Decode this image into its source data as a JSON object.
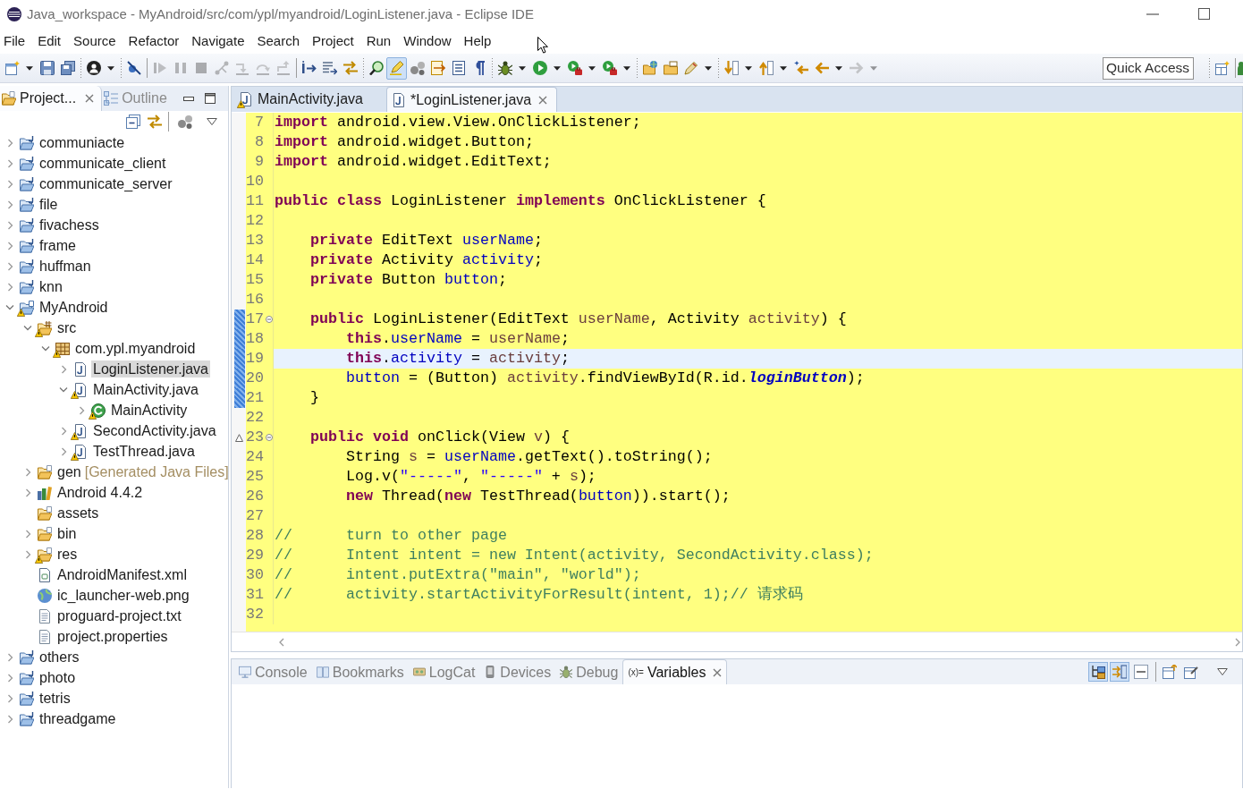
{
  "window": {
    "title": "Java_workspace - MyAndroid/src/com/ypl/myandroid/LoginListener.java - Eclipse IDE"
  },
  "menu": [
    "File",
    "Edit",
    "Source",
    "Refactor",
    "Navigate",
    "Search",
    "Project",
    "Run",
    "Window",
    "Help"
  ],
  "toolbar": {
    "buttons": [
      {
        "selected": false,
        "disabled": false
      },
      {
        "selected": false,
        "disabled": false
      },
      {
        "selected": false,
        "disabled": false
      },
      {
        "selected": false,
        "disabled": false
      },
      {
        "selected": false,
        "disabled": false
      },
      {
        "selected": false,
        "disabled": true
      },
      {
        "selected": false,
        "disabled": true
      },
      {
        "selected": false,
        "disabled": true
      },
      {
        "selected": false,
        "disabled": true
      },
      {
        "selected": false,
        "disabled": true
      },
      {
        "selected": false,
        "disabled": true
      },
      {
        "selected": false,
        "disabled": true
      },
      {
        "selected": false,
        "disabled": false
      },
      {
        "selected": false,
        "disabled": false
      },
      {
        "selected": false,
        "disabled": false
      },
      {
        "selected": false,
        "disabled": false
      },
      {
        "selected": true,
        "disabled": false
      },
      {
        "selected": false,
        "disabled": false
      },
      {
        "selected": false,
        "disabled": false
      },
      {
        "selected": false,
        "disabled": false
      },
      {
        "selected": false,
        "disabled": false
      },
      {
        "selected": false,
        "disabled": false
      },
      {
        "selected": false,
        "disabled": false
      },
      {
        "selected": false,
        "disabled": false
      },
      {
        "selected": false,
        "disabled": false
      },
      {
        "selected": false,
        "disabled": false
      },
      {
        "selected": false,
        "disabled": false
      },
      {
        "selected": false,
        "disabled": false
      },
      {
        "selected": false,
        "disabled": false
      },
      {
        "selected": false,
        "disabled": false
      },
      {
        "selected": false,
        "disabled": false
      },
      {
        "selected": false,
        "disabled": false
      },
      {
        "selected": false,
        "disabled": true
      }
    ],
    "quick_access": {
      "placeholder": "Quick Access"
    }
  },
  "project_explorer": {
    "tabs": [
      {
        "label": "Project...",
        "selected": true
      },
      {
        "label": "Outline",
        "selected": false
      }
    ],
    "tree": [
      {
        "label": "communiacte",
        "kind": "project",
        "expanded": false,
        "selected": false,
        "warning": false
      },
      {
        "label": "communicate_client",
        "kind": "project",
        "expanded": false,
        "selected": false,
        "warning": false
      },
      {
        "label": "communicate_server",
        "kind": "project",
        "expanded": false,
        "selected": false,
        "warning": false
      },
      {
        "label": "file",
        "kind": "project",
        "expanded": false,
        "selected": false,
        "warning": false
      },
      {
        "label": "fivachess",
        "kind": "project",
        "expanded": false,
        "selected": false,
        "warning": false
      },
      {
        "label": "frame",
        "kind": "project",
        "expanded": false,
        "selected": false,
        "warning": false
      },
      {
        "label": "huffman",
        "kind": "project",
        "expanded": false,
        "selected": false,
        "warning": false
      },
      {
        "label": "knn",
        "kind": "project",
        "expanded": false,
        "selected": false,
        "warning": false
      },
      {
        "label": "MyAndroid",
        "kind": "android-project",
        "expanded": true,
        "selected": false,
        "warning": true,
        "children": [
          {
            "label": "src",
            "kind": "source-folder",
            "expanded": true,
            "selected": false,
            "warning": true,
            "children": [
              {
                "label": "com.ypl.myandroid",
                "kind": "package",
                "expanded": true,
                "selected": false,
                "warning": true,
                "children": [
                  {
                    "label": "LoginListener.java",
                    "kind": "java-file",
                    "expanded": false,
                    "selected": true,
                    "warning": false
                  },
                  {
                    "label": "MainActivity.java",
                    "kind": "java-file",
                    "expanded": true,
                    "selected": false,
                    "warning": true,
                    "children": [
                      {
                        "label": "MainActivity",
                        "kind": "class",
                        "expanded": false,
                        "selected": false,
                        "warning": true
                      }
                    ]
                  },
                  {
                    "label": "SecondActivity.java",
                    "kind": "java-file",
                    "expanded": false,
                    "selected": false,
                    "warning": true
                  },
                  {
                    "label": "TestThread.java",
                    "kind": "java-file",
                    "expanded": false,
                    "selected": false,
                    "warning": true
                  }
                ]
              }
            ]
          },
          {
            "label": "gen",
            "note": "[Generated Java Files]",
            "kind": "generated-folder",
            "expanded": false,
            "selected": false,
            "warning": false
          },
          {
            "label": "Android 4.4.2",
            "kind": "library",
            "expanded": false,
            "selected": false,
            "warning": false
          },
          {
            "label": "assets",
            "kind": "folder",
            "selected": false,
            "warning": false
          },
          {
            "label": "bin",
            "kind": "folder",
            "expanded": false,
            "selected": false,
            "warning": false
          },
          {
            "label": "res",
            "kind": "folder",
            "expanded": false,
            "selected": false,
            "warning": true
          },
          {
            "label": "AndroidManifest.xml",
            "kind": "xml-file",
            "selected": false,
            "warning": false
          },
          {
            "label": "ic_launcher-web.png",
            "kind": "image-file",
            "selected": false,
            "warning": false
          },
          {
            "label": "proguard-project.txt",
            "kind": "text-file",
            "selected": false,
            "warning": false
          },
          {
            "label": "project.properties",
            "kind": "text-file",
            "selected": false,
            "warning": false
          }
        ]
      },
      {
        "label": "others",
        "kind": "project",
        "expanded": false,
        "selected": false,
        "warning": false
      },
      {
        "label": "photo",
        "kind": "project",
        "expanded": false,
        "selected": false,
        "warning": false
      },
      {
        "label": "tetris",
        "kind": "project",
        "expanded": false,
        "selected": false,
        "warning": false
      },
      {
        "label": "threadgame",
        "kind": "project",
        "expanded": false,
        "selected": false,
        "warning": false
      }
    ]
  },
  "editor": {
    "tabs": [
      {
        "label": "MainActivity.java",
        "selected": false,
        "warning": true
      },
      {
        "label": "*LoginListener.java",
        "selected": true,
        "warning": false
      }
    ],
    "lines": [
      {
        "number": "7",
        "tokens": [
          {
            "kind": "keyword",
            "text": "import"
          },
          {
            "kind": "plain",
            "text": " android.view.View.OnClickListener;"
          }
        ],
        "current": false,
        "changed": false,
        "foldable": false,
        "override": false
      },
      {
        "number": "8",
        "tokens": [
          {
            "kind": "keyword",
            "text": "import"
          },
          {
            "kind": "plain",
            "text": " android.widget.Button;"
          }
        ],
        "current": false,
        "changed": false,
        "foldable": false,
        "override": false
      },
      {
        "number": "9",
        "tokens": [
          {
            "kind": "keyword",
            "text": "import"
          },
          {
            "kind": "plain",
            "text": " android.widget.EditText;"
          }
        ],
        "current": false,
        "changed": false,
        "foldable": false,
        "override": false
      },
      {
        "number": "10",
        "current": false,
        "changed": false,
        "foldable": false,
        "override": false
      },
      {
        "number": "11",
        "tokens": [
          {
            "kind": "keyword",
            "text": "public"
          },
          {
            "kind": "keyword",
            "text": " class"
          },
          {
            "kind": "plain",
            "text": " LoginListener "
          },
          {
            "kind": "keyword",
            "text": "implements"
          },
          {
            "kind": "plain",
            "text": " OnClickListener {"
          }
        ],
        "current": false,
        "changed": false,
        "foldable": false,
        "override": false
      },
      {
        "number": "12",
        "current": false,
        "changed": false,
        "foldable": false,
        "override": false
      },
      {
        "number": "13",
        "tokens": [
          {
            "kind": "keyword",
            "text": "    private"
          },
          {
            "kind": "plain",
            "text": " EditText "
          },
          {
            "kind": "field",
            "text": "userName"
          },
          {
            "kind": "plain",
            "text": ";"
          }
        ],
        "current": false,
        "changed": false,
        "foldable": false,
        "override": false
      },
      {
        "number": "14",
        "tokens": [
          {
            "kind": "keyword",
            "text": "    private"
          },
          {
            "kind": "plain",
            "text": " Activity "
          },
          {
            "kind": "field",
            "text": "activity"
          },
          {
            "kind": "plain",
            "text": ";"
          }
        ],
        "current": false,
        "changed": false,
        "foldable": false,
        "override": false
      },
      {
        "number": "15",
        "tokens": [
          {
            "kind": "keyword",
            "text": "    private"
          },
          {
            "kind": "plain",
            "text": " Button "
          },
          {
            "kind": "field",
            "text": "button"
          },
          {
            "kind": "plain",
            "text": ";"
          }
        ],
        "current": false,
        "changed": false,
        "foldable": false,
        "override": false
      },
      {
        "number": "16",
        "current": false,
        "changed": false,
        "foldable": false,
        "override": false
      },
      {
        "number": "17",
        "tokens": [
          {
            "kind": "keyword",
            "text": "    public"
          },
          {
            "kind": "plain",
            "text": " LoginListener(EditText "
          },
          {
            "kind": "parameter",
            "text": "userName"
          },
          {
            "kind": "plain",
            "text": ", Activity "
          },
          {
            "kind": "parameter",
            "text": "activity"
          },
          {
            "kind": "plain",
            "text": ") {"
          }
        ],
        "current": false,
        "changed": true,
        "foldable": true,
        "override": false
      },
      {
        "number": "18",
        "tokens": [
          {
            "kind": "keyword",
            "text": "        this"
          },
          {
            "kind": "plain",
            "text": "."
          },
          {
            "kind": "field",
            "text": "userName"
          },
          {
            "kind": "plain",
            "text": " = "
          },
          {
            "kind": "parameter",
            "text": "userName"
          },
          {
            "kind": "plain",
            "text": ";"
          }
        ],
        "current": false,
        "changed": true,
        "foldable": false,
        "override": false
      },
      {
        "number": "19",
        "tokens": [
          {
            "kind": "keyword",
            "text": "        this"
          },
          {
            "kind": "plain",
            "text": "."
          },
          {
            "kind": "field",
            "text": "activity"
          },
          {
            "kind": "plain",
            "text": " = "
          },
          {
            "kind": "parameter",
            "text": "activity"
          },
          {
            "kind": "plain",
            "text": ";"
          }
        ],
        "current": true,
        "changed": true,
        "foldable": false,
        "override": false
      },
      {
        "number": "20",
        "tokens": [
          {
            "kind": "field",
            "text": "        button"
          },
          {
            "kind": "plain",
            "text": " = (Button) "
          },
          {
            "kind": "parameter",
            "text": "activity"
          },
          {
            "kind": "plain",
            "text": ".findViewById(R.id."
          },
          {
            "kind": "constant",
            "text": "loginButton"
          },
          {
            "kind": "plain",
            "text": ");"
          }
        ],
        "current": false,
        "changed": true,
        "foldable": false,
        "override": false
      },
      {
        "number": "21",
        "tokens": [
          {
            "kind": "plain",
            "text": "    }"
          }
        ],
        "current": false,
        "changed": true,
        "foldable": false,
        "override": false
      },
      {
        "number": "22",
        "current": false,
        "changed": false,
        "foldable": false,
        "override": false
      },
      {
        "number": "23",
        "tokens": [
          {
            "kind": "keyword",
            "text": "    public"
          },
          {
            "kind": "keyword",
            "text": " void"
          },
          {
            "kind": "plain",
            "text": " onClick(View "
          },
          {
            "kind": "parameter",
            "text": "v"
          },
          {
            "kind": "plain",
            "text": ") {"
          }
        ],
        "current": false,
        "changed": false,
        "foldable": true,
        "override": true
      },
      {
        "number": "24",
        "tokens": [
          {
            "kind": "plain",
            "text": "        String "
          },
          {
            "kind": "local",
            "text": "s"
          },
          {
            "kind": "plain",
            "text": " = "
          },
          {
            "kind": "field",
            "text": "userName"
          },
          {
            "kind": "plain",
            "text": ".getText().toString();"
          }
        ],
        "current": false,
        "changed": false,
        "foldable": false,
        "override": false
      },
      {
        "number": "25",
        "tokens": [
          {
            "kind": "plain",
            "text": "        Log.v("
          },
          {
            "kind": "string",
            "text": "\"-----\""
          },
          {
            "kind": "plain",
            "text": ", "
          },
          {
            "kind": "string",
            "text": "\"-----\""
          },
          {
            "kind": "plain",
            "text": " + "
          },
          {
            "kind": "local",
            "text": "s"
          },
          {
            "kind": "plain",
            "text": ");"
          }
        ],
        "current": false,
        "changed": false,
        "foldable": false,
        "override": false
      },
      {
        "number": "26",
        "tokens": [
          {
            "kind": "keyword",
            "text": "        new"
          },
          {
            "kind": "plain",
            "text": " Thread("
          },
          {
            "kind": "keyword",
            "text": "new"
          },
          {
            "kind": "plain",
            "text": " TestThread("
          },
          {
            "kind": "field",
            "text": "button"
          },
          {
            "kind": "plain",
            "text": ")).start();"
          }
        ],
        "current": false,
        "changed": false,
        "foldable": false,
        "override": false
      },
      {
        "number": "27",
        "current": false,
        "changed": false,
        "foldable": false,
        "override": false
      },
      {
        "number": "28",
        "tokens": [
          {
            "kind": "comment",
            "text": "//      turn to other page"
          }
        ],
        "current": false,
        "changed": false,
        "foldable": false,
        "override": false
      },
      {
        "number": "29",
        "tokens": [
          {
            "kind": "comment",
            "text": "//      Intent intent = new Intent(activity, SecondActivity.class);"
          }
        ],
        "current": false,
        "changed": false,
        "foldable": false,
        "override": false
      },
      {
        "number": "30",
        "tokens": [
          {
            "kind": "comment",
            "text": "//      intent.putExtra(\"main\", \"world\");"
          }
        ],
        "current": false,
        "changed": false,
        "foldable": false,
        "override": false
      },
      {
        "number": "31",
        "tokens": [
          {
            "kind": "comment",
            "text": "//      activity.startActivityForResult(intent, 1);// 请求码"
          }
        ],
        "current": false,
        "changed": false,
        "foldable": false,
        "override": false
      },
      {
        "number": "32",
        "current": false,
        "changed": false,
        "foldable": false,
        "override": false
      }
    ]
  },
  "bottom_panel": {
    "tabs": [
      {
        "label": "Console",
        "selected": false
      },
      {
        "label": "Bookmarks",
        "selected": false
      },
      {
        "label": "LogCat",
        "selected": false
      },
      {
        "label": "Devices",
        "selected": false
      },
      {
        "label": "Debug",
        "selected": false
      },
      {
        "label": "Variables",
        "selected": true,
        "icon_text": "(x)="
      }
    ],
    "toolbar": {
      "buttons": [
        {
          "selected": true
        },
        {
          "selected": true
        },
        {
          "selected": false
        },
        {
          "selected": false
        },
        {
          "selected": false
        }
      ]
    }
  }
}
